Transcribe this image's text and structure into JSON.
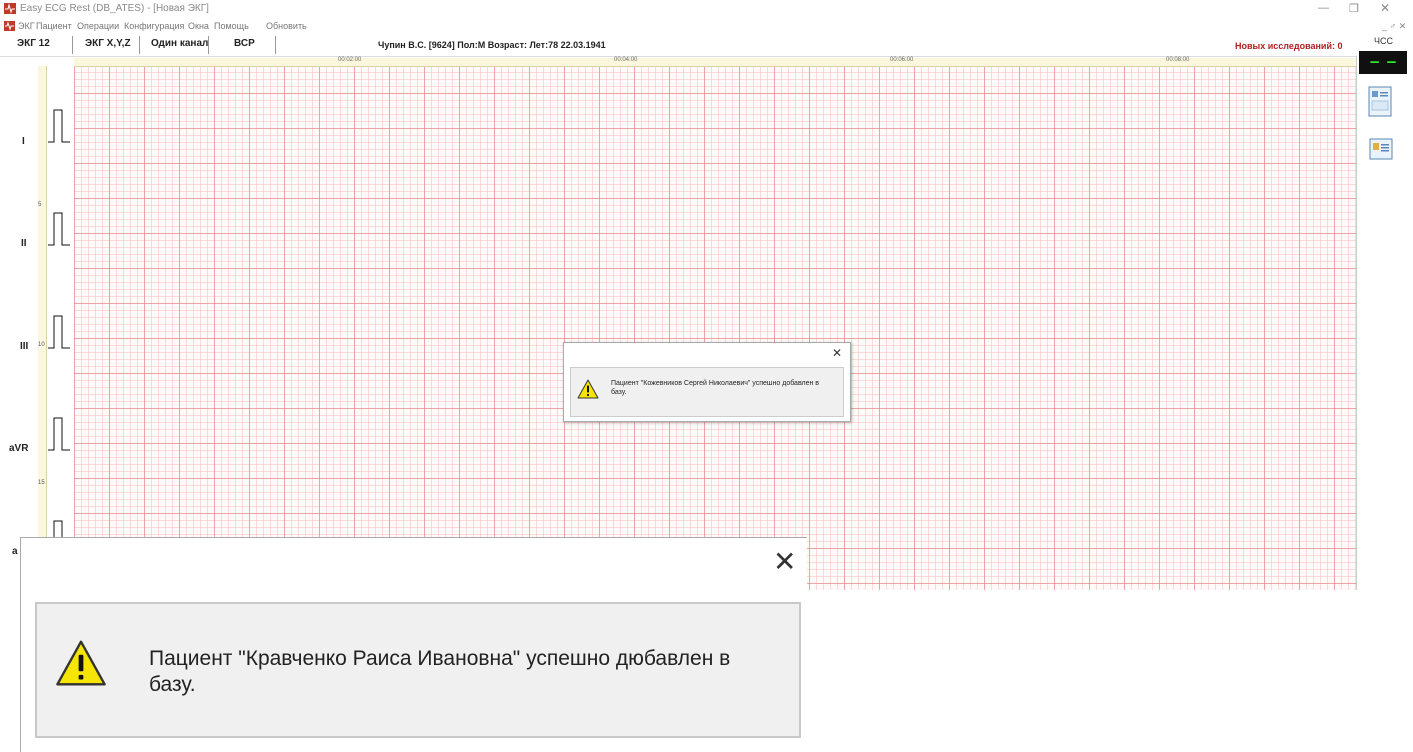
{
  "window": {
    "title": "Easy ECG Rest (DB_ATES) - [Новая ЭКГ]",
    "controls": [
      "—",
      "❐",
      "✕"
    ]
  },
  "menu": {
    "items": [
      "ЭКГ",
      "Пациент",
      "Операции",
      "Конфигурация",
      "Окна",
      "Помощь",
      "Обновить"
    ],
    "mdi_controls": "_ ♂ ✕"
  },
  "toolbar": {
    "tabs": [
      "ЭКГ 12",
      "ЭКГ X,Y,Z",
      "Один канал",
      "ВСР"
    ],
    "patient_info": "Чупин В.С. [9624]  Пол:М  Возраст: Лет:78  22.03.1941",
    "new_studies": "Новых исследований: 0",
    "hr_label": "ЧСС"
  },
  "ecg": {
    "time_marks": [
      "00:02:00",
      "00:04:00",
      "00:06:00",
      "00:08:00"
    ],
    "ruler_numbers": [
      "5",
      "10",
      "15"
    ],
    "leads": [
      "I",
      "II",
      "III",
      "aVR",
      "a"
    ]
  },
  "hr_display": {
    "value": "– –"
  },
  "side_icons": [
    "patient-card-icon",
    "patient-list-icon"
  ],
  "dialog_small": {
    "close": "✕",
    "message": "Пациент \"Кожевников Сергей Николаевич\" успешно добавлен в базу."
  },
  "dialog_large": {
    "close": "✕",
    "message": "Пациент \"Кравченко Раиса Ивановна\" успешно дюбавлен в базу."
  },
  "colors": {
    "grid_major": "#e27878",
    "grid_minor": "#f5bebe",
    "new_studies": "#b02020",
    "hr_display_text": "#2ee82e",
    "warning_yellow": "#f5e500"
  }
}
